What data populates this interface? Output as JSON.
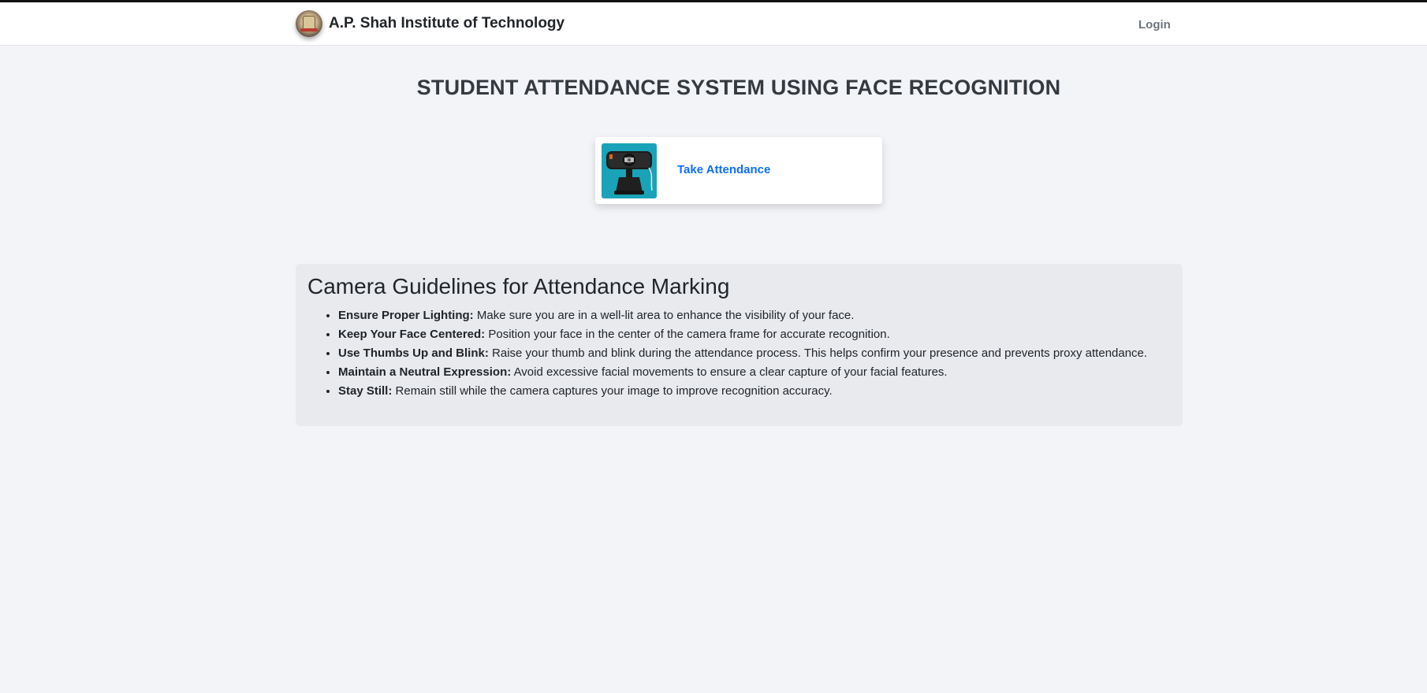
{
  "navbar": {
    "brand": "A.P. Shah Institute of Technology",
    "logo_icon": "institute-seal-icon",
    "login_label": "Login"
  },
  "main": {
    "title": "STUDENT ATTENDANCE SYSTEM USING FACE RECOGNITION",
    "attendance_card": {
      "label": "Take Attendance",
      "icon": "webcam-icon"
    }
  },
  "guidelines": {
    "heading": "Camera Guidelines for Attendance Marking",
    "items": [
      {
        "title": "Ensure Proper Lighting:",
        "text": "Make sure you are in a well-lit area to enhance the visibility of your face."
      },
      {
        "title": "Keep Your Face Centered:",
        "text": "Position your face in the center of the camera frame for accurate recognition."
      },
      {
        "title": "Use Thumbs Up and Blink:",
        "text": "Raise your thumb and blink during the attendance process. This helps confirm your presence and prevents proxy attendance."
      },
      {
        "title": "Maintain a Neutral Expression:",
        "text": "Avoid excessive facial movements to ensure a clear capture of your facial features."
      },
      {
        "title": "Stay Still:",
        "text": "Remain still while the camera captures your image to improve recognition accuracy."
      }
    ]
  },
  "colors": {
    "link": "#0d6efd",
    "card_image_bg": "#1aa3b8",
    "page_bg": "#f3f4f8",
    "guidelines_bg": "#e8eaee"
  }
}
